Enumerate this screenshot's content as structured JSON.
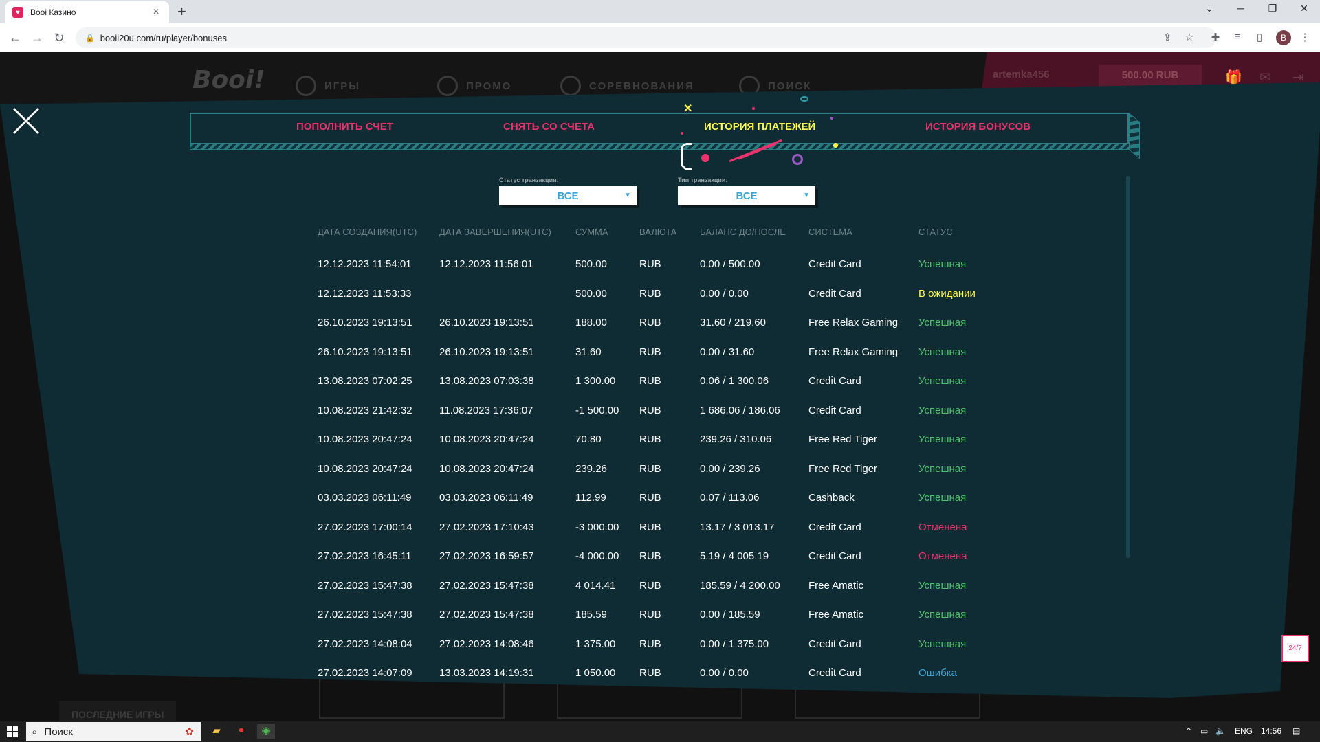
{
  "browser": {
    "tab_title": "Booi Казино",
    "favicon": "booi-favicon",
    "url": "booii20u.com/ru/player/bonuses",
    "profile_initial": "B"
  },
  "site": {
    "logo": "Booi!",
    "nav": [
      "ИГРЫ",
      "ПРОМО",
      "СОРЕВНОВАНИЯ",
      "ПОИСК"
    ],
    "username": "artemka456",
    "balance": "500.00 RUB",
    "recent_games_label": "ПОСЛЕДНИЕ ИГРЫ"
  },
  "modal": {
    "tabs": [
      "ПОПОЛНИТЬ СЧЕТ",
      "СНЯТЬ СО СЧЕТА",
      "ИСТОРИЯ ПЛАТЕЖЕЙ",
      "ИСТОРИЯ БОНУСОВ"
    ],
    "active_tab": "ИСТОРИЯ ПЛАТЕЖЕЙ",
    "filters": {
      "status_label": "Статус транзакции:",
      "status_value": "ВСЕ",
      "type_label": "Тип транзакции:",
      "type_value": "ВСЕ"
    },
    "columns": [
      "ДАТА СОЗДАНИЯ(UTC)",
      "ДАТА ЗАВЕРШЕНИЯ(UTC)",
      "СУММА",
      "ВАЛЮТА",
      "БАЛАНС ДО/ПОСЛЕ",
      "СИСТЕМА",
      "СТАТУС"
    ],
    "rows": [
      [
        "12.12.2023 11:54:01",
        "12.12.2023 11:56:01",
        "500.00",
        "RUB",
        "0.00 / 500.00",
        "Credit Card",
        "Успешная"
      ],
      [
        "12.12.2023 11:53:33",
        "",
        "500.00",
        "RUB",
        "0.00 / 0.00",
        "Credit Card",
        "В ожидании"
      ],
      [
        "26.10.2023 19:13:51",
        "26.10.2023 19:13:51",
        "188.00",
        "RUB",
        "31.60 / 219.60",
        "Free Relax Gaming",
        "Успешная"
      ],
      [
        "26.10.2023 19:13:51",
        "26.10.2023 19:13:51",
        "31.60",
        "RUB",
        "0.00 / 31.60",
        "Free Relax Gaming",
        "Успешная"
      ],
      [
        "13.08.2023 07:02:25",
        "13.08.2023 07:03:38",
        "1 300.00",
        "RUB",
        "0.06 / 1 300.06",
        "Credit Card",
        "Успешная"
      ],
      [
        "10.08.2023 21:42:32",
        "11.08.2023 17:36:07",
        "-1 500.00",
        "RUB",
        "1 686.06 / 186.06",
        "Credit Card",
        "Успешная"
      ],
      [
        "10.08.2023 20:47:24",
        "10.08.2023 20:47:24",
        "70.80",
        "RUB",
        "239.26 / 310.06",
        "Free Red Tiger",
        "Успешная"
      ],
      [
        "10.08.2023 20:47:24",
        "10.08.2023 20:47:24",
        "239.26",
        "RUB",
        "0.00 / 239.26",
        "Free Red Tiger",
        "Успешная"
      ],
      [
        "03.03.2023 06:11:49",
        "03.03.2023 06:11:49",
        "112.99",
        "RUB",
        "0.07 / 113.06",
        "Cashback",
        "Успешная"
      ],
      [
        "27.02.2023 17:00:14",
        "27.02.2023 17:10:43",
        "-3 000.00",
        "RUB",
        "13.17 / 3 013.17",
        "Credit Card",
        "Отменена"
      ],
      [
        "27.02.2023 16:45:11",
        "27.02.2023 16:59:57",
        "-4 000.00",
        "RUB",
        "5.19 / 4 005.19",
        "Credit Card",
        "Отменена"
      ],
      [
        "27.02.2023 15:47:38",
        "27.02.2023 15:47:38",
        "4 014.41",
        "RUB",
        "185.59 / 4 200.00",
        "Free Amatic",
        "Успешная"
      ],
      [
        "27.02.2023 15:47:38",
        "27.02.2023 15:47:38",
        "185.59",
        "RUB",
        "0.00 / 185.59",
        "Free Amatic",
        "Успешная"
      ],
      [
        "27.02.2023 14:08:04",
        "27.02.2023 14:08:46",
        "1 375.00",
        "RUB",
        "0.00 / 1 375.00",
        "Credit Card",
        "Успешная"
      ],
      [
        "27.02.2023 14:07:09",
        "13.03.2023 14:19:31",
        "1 050.00",
        "RUB",
        "0.00 / 0.00",
        "Credit Card",
        "Ошибка"
      ]
    ],
    "support_label": "24/7"
  },
  "taskbar": {
    "search_placeholder": "Поиск",
    "language": "ENG",
    "time": "14:56"
  },
  "colors": {
    "modal_bg": "#0f2b33",
    "accent_pink": "#e8336d",
    "active_yellow": "#fff94c",
    "status_success": "#4fc36d",
    "status_error": "#3aa6d8"
  }
}
